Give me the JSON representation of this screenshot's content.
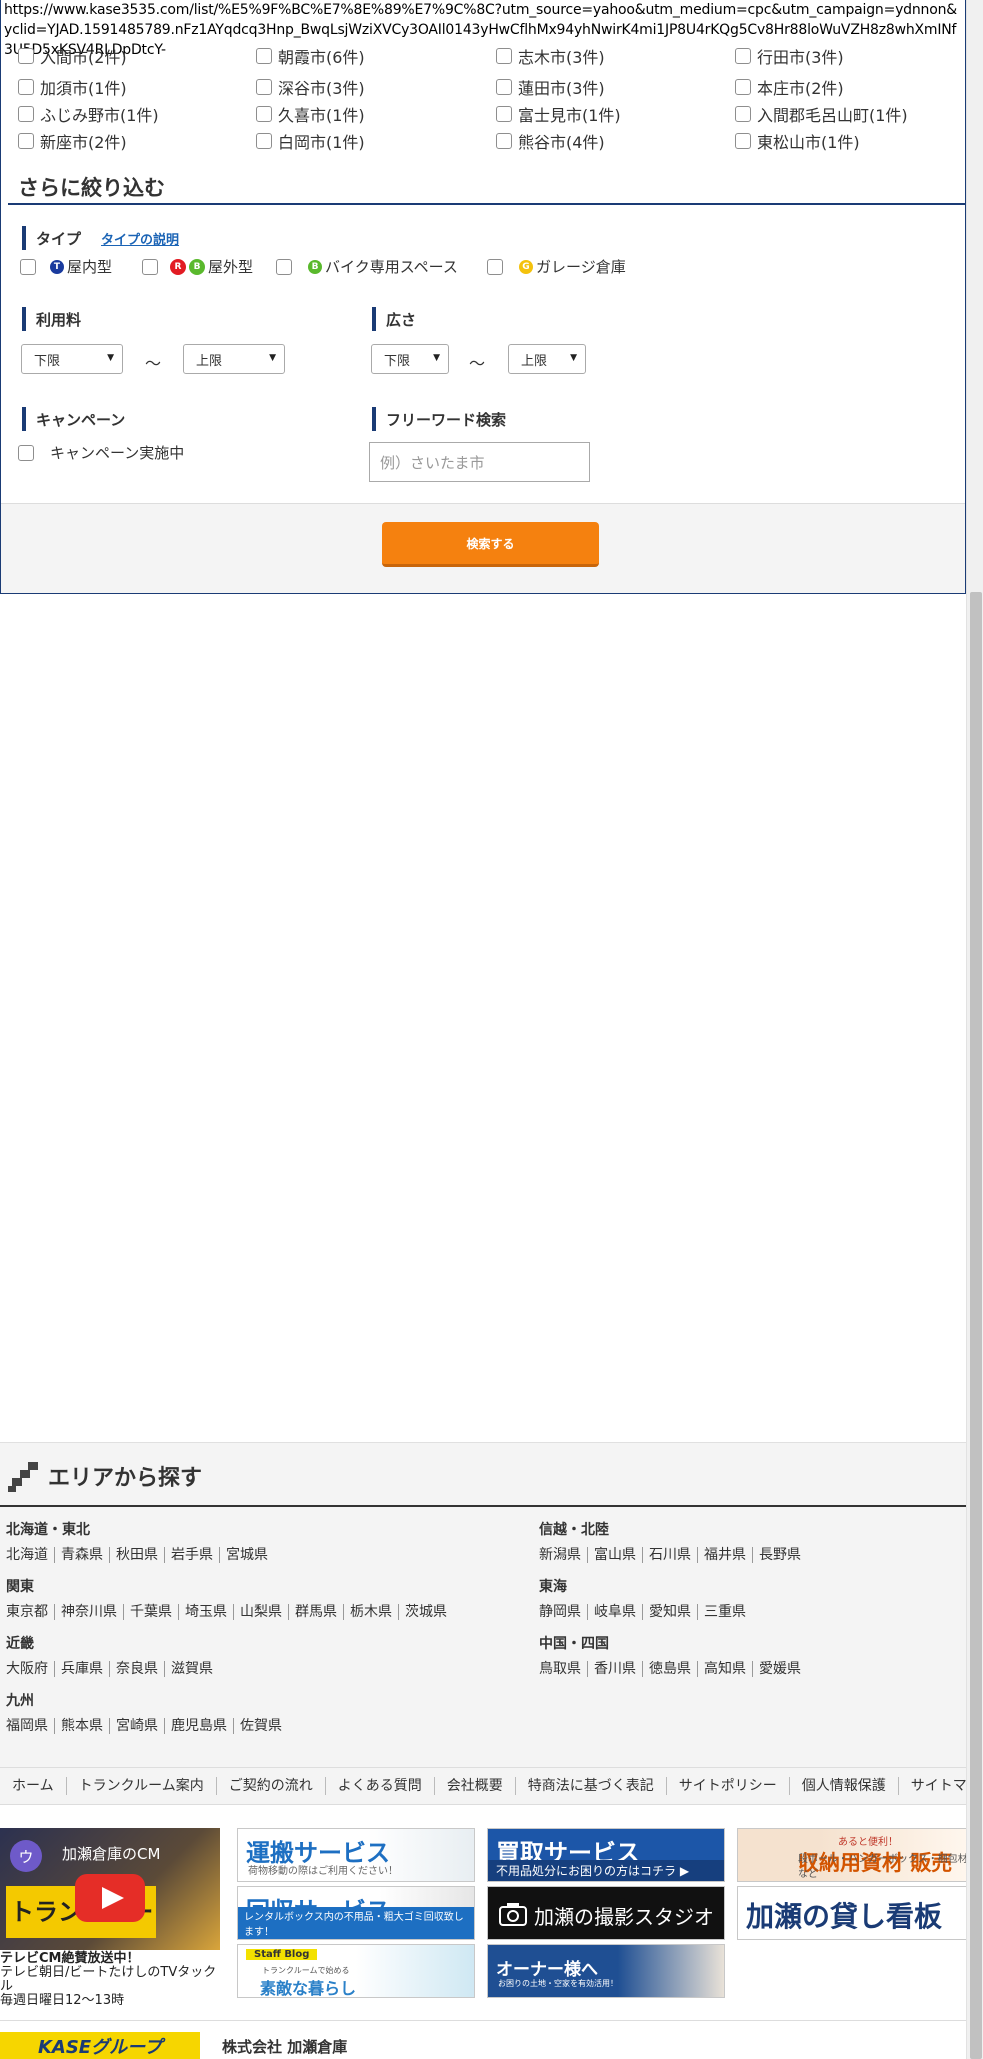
{
  "url": "https://www.kase3535.com/list/%E5%9F%BC%E7%8E%89%E7%9C%8C?utm_source=yahoo&utm_medium=cpc&utm_campaign=ydnnon&yclid=YJAD.1591485789.nFz1AYqdcq3Hnp_BwqLsjWziXVCy3OAIl0143yHwCflhMx94yhNwirK4mi1JP8U4rKQg5Cv8Hr88loWuVZH8z8whXmINf3U5D5xKSV4RLDpDtcY-",
  "cities": {
    "row0": [
      {
        "label": "入間市(2件)"
      },
      {
        "label": "朝霞市(6件)"
      },
      {
        "label": "志木市(3件)"
      },
      {
        "label": "行田市(3件)"
      }
    ],
    "row1": [
      {
        "label": "加須市(1件)"
      },
      {
        "label": "深谷市(3件)"
      },
      {
        "label": "蓮田市(3件)"
      },
      {
        "label": "本庄市(2件)"
      }
    ],
    "row2": [
      {
        "label": "ふじみ野市(1件)"
      },
      {
        "label": "久喜市(1件)"
      },
      {
        "label": "富士見市(1件)"
      },
      {
        "label": "入間郡毛呂山町(1件)"
      }
    ],
    "row3": [
      {
        "label": "新座市(2件)"
      },
      {
        "label": "白岡市(1件)"
      },
      {
        "label": "熊谷市(4件)"
      },
      {
        "label": "東松山市(1件)"
      }
    ]
  },
  "refine": {
    "title": "さらに絞り込む",
    "type_label": "タイプ",
    "type_help": "タイプの説明",
    "types": [
      {
        "badge": "T",
        "label": "屋内型",
        "color": "#1a3b9e"
      },
      {
        "badge": "R",
        "badge2": "B",
        "label": "屋外型",
        "color": "#e21b23",
        "color2": "#5ab92d"
      },
      {
        "badge": "B",
        "label": "バイク専用スペース",
        "color": "#5ab92d"
      },
      {
        "badge": "G",
        "label": "ガレージ倉庫",
        "color": "#f4c20d"
      }
    ],
    "fee_label": "利用料",
    "size_label": "広さ",
    "lower": "下限",
    "upper": "上限",
    "tilde": "～",
    "campaign_label": "キャンペーン",
    "campaign_option": "キャンペーン実施中",
    "freeword_label": "フリーワード検索",
    "freeword_placeholder": "例）さいたま市",
    "search_button": "検索する"
  },
  "area": {
    "title": "エリアから探す",
    "regions": {
      "hokkaido": {
        "name": "北海道・東北",
        "prefs": [
          "北海道",
          "青森県",
          "秋田県",
          "岩手県",
          "宮城県"
        ]
      },
      "shinetsu": {
        "name": "信越・北陸",
        "prefs": [
          "新潟県",
          "富山県",
          "石川県",
          "福井県",
          "長野県"
        ]
      },
      "kanto": {
        "name": "関東",
        "prefs": [
          "東京都",
          "神奈川県",
          "千葉県",
          "埼玉県",
          "山梨県",
          "群馬県",
          "栃木県",
          "茨城県"
        ]
      },
      "tokai": {
        "name": "東海",
        "prefs": [
          "静岡県",
          "岐阜県",
          "愛知県",
          "三重県"
        ]
      },
      "kinki": {
        "name": "近畿",
        "prefs": [
          "大阪府",
          "兵庫県",
          "奈良県",
          "滋賀県"
        ]
      },
      "chugoku": {
        "name": "中国・四国",
        "prefs": [
          "鳥取県",
          "香川県",
          "徳島県",
          "高知県",
          "愛媛県"
        ]
      },
      "kyushu": {
        "name": "九州",
        "prefs": [
          "福岡県",
          "熊本県",
          "宮崎県",
          "鹿児島県",
          "佐賀県"
        ]
      }
    }
  },
  "footer_nav": [
    "ホーム",
    "トランクルーム案内",
    "ご契約の流れ",
    "よくある質問",
    "会社概要",
    "特商法に基づく表記",
    "サイトポリシー",
    "個人情報保護",
    "サイトマップ"
  ],
  "video": {
    "avatar": "ウ",
    "title": "加瀬倉庫のCM",
    "strip": "トランクルーム",
    "caption1": "テレビCM絶賛放送中！",
    "caption2": "テレビ朝日/ビートたけしのTVタックル",
    "caption3": "毎週日曜日12～13時"
  },
  "banners": {
    "unpan": {
      "title": "運搬サービス",
      "sub": "荷物移動の際はご利用ください！"
    },
    "kaitori": {
      "title": "買取サービス",
      "sub": "不用品処分にお困りの方はコチラ ▶"
    },
    "shizai_small": "あると便利！",
    "shizai": {
      "title": "収納用資材 販売",
      "sub": "段ボール・ハンガーボックス・梱包材など"
    },
    "kaishu": {
      "title": "回収サービス",
      "sub": "レンタルボックス内の不用品・粗大ゴミ回収致します！"
    },
    "studio": {
      "title": "加瀬の撮影スタジオ"
    },
    "kanban": {
      "title": "加瀬の貸し看板"
    },
    "blog": {
      "small": "Staff Blog",
      "sub": "トランクルームで始める",
      "title": "素敵な暮らし"
    },
    "owner": {
      "title": "オーナー様へ",
      "sub": "お困りの土地・空家を有効活用！"
    }
  },
  "logo": "KASEグループ",
  "company": "株式会社 加瀬倉庫"
}
